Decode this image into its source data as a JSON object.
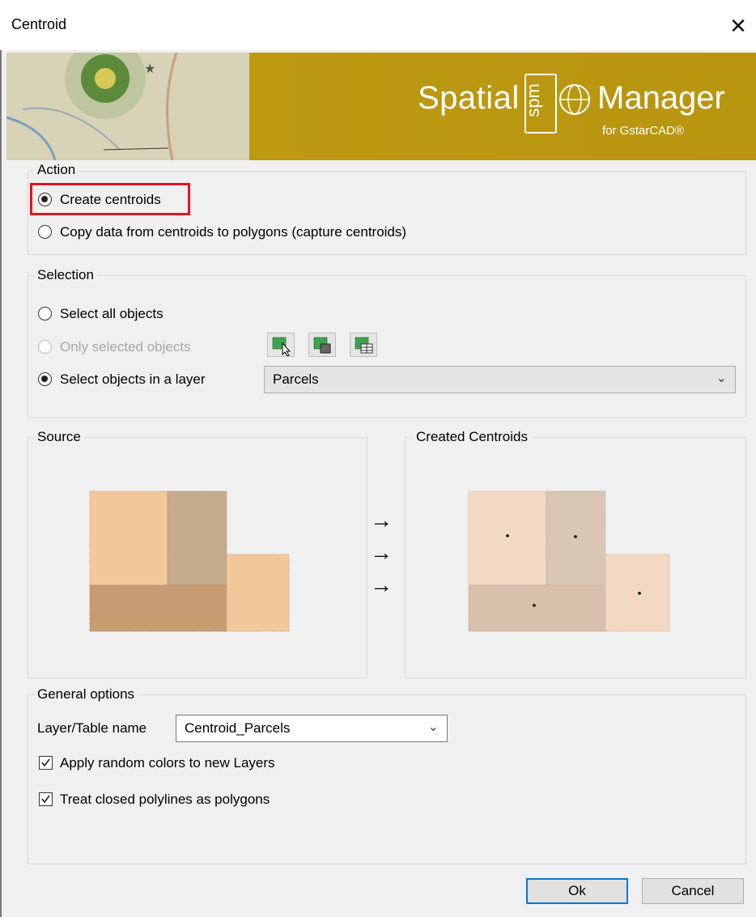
{
  "window": {
    "title": "Centroid",
    "close_label": "✕"
  },
  "banner": {
    "logo_word1": "Spatial",
    "logo_box": "spm",
    "logo_word2": "Manager",
    "logo_sub": "for GstarCAD®"
  },
  "action": {
    "legend": "Action",
    "options": [
      {
        "label": "Create centroids",
        "selected": true
      },
      {
        "label": "Copy data from centroids to polygons (capture centroids)",
        "selected": false
      }
    ]
  },
  "selection": {
    "legend": "Selection",
    "options": [
      {
        "label": "Select all objects",
        "selected": false,
        "enabled": true
      },
      {
        "label": "Only selected objects",
        "selected": false,
        "enabled": false
      },
      {
        "label": "Select objects in a layer",
        "selected": true,
        "enabled": true
      }
    ],
    "layer_combo_value": "Parcels"
  },
  "source": {
    "legend": "Source"
  },
  "created": {
    "legend": "Created Centroids"
  },
  "arrows": [
    "→",
    "→",
    "→"
  ],
  "general": {
    "legend": "General options",
    "layer_table_label": "Layer/Table name",
    "layer_table_value": "Centroid_Parcels",
    "checks": [
      {
        "label": "Apply random colors to new Layers",
        "checked": true
      },
      {
        "label": "Treat closed polylines as polygons",
        "checked": true
      }
    ]
  },
  "buttons": {
    "ok": "Ok",
    "cancel": "Cancel"
  },
  "colors": {
    "banner_gold": "#b8950f",
    "highlight": "#e81123",
    "default_button_border": "#0078d7"
  }
}
